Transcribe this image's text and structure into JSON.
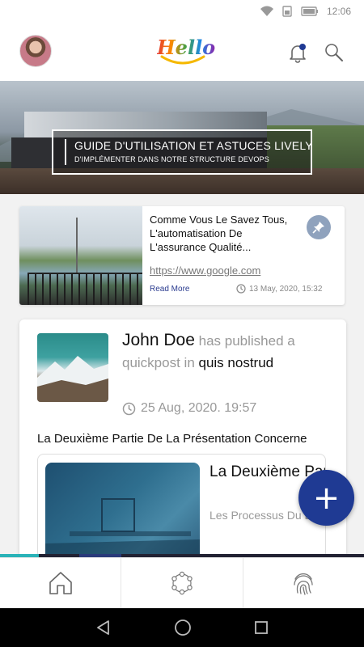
{
  "status_bar": {
    "time": "12:06"
  },
  "header": {
    "logo_text": "Hello",
    "icons": {
      "notification": "bell-icon",
      "search": "search-icon"
    },
    "notification_badge_color": "#1f3a93"
  },
  "hero": {
    "title": "GUIDE D'UTILISATION ET ASTUCES LIVELY",
    "subtitle": "D'IMPLÉMENTER DANS NOTRE STRUCTURE DEVOPS"
  },
  "article": {
    "title": "Comme Vous Le Savez Tous, L'automatisation De L'assurance Qualité...",
    "link": "https://www.google.com",
    "read_more": "Read More",
    "date": "13 May, 2020, 15:32",
    "pin_icon": "pin-icon"
  },
  "post": {
    "author": "John Doe",
    "action": " has published a quickpost in ",
    "target": "quis nostrud",
    "date": "25 Aug, 2020. 19:57",
    "text": "La Deuxième Partie De La Présentation Concerne",
    "embed": {
      "title": "La Deuxième Partie De La",
      "description": "Les Processus Du DevOps Qui Ont Été"
    }
  },
  "fab": {
    "label": "+"
  },
  "bottom_nav": {
    "tabs": [
      {
        "icon": "home-icon"
      },
      {
        "icon": "community-icon"
      },
      {
        "icon": "fingerprint-icon"
      }
    ]
  },
  "colors": {
    "accent": "#1f3a93",
    "active_tab": "#2ab3b8",
    "link": "#2a3b8f"
  }
}
